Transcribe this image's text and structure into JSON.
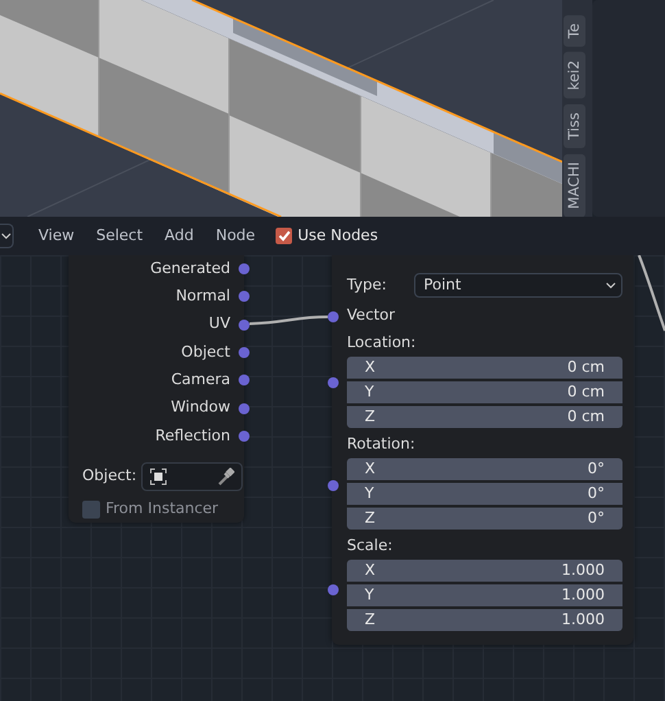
{
  "viewport": {
    "side_tabs": [
      "Te",
      "kei2",
      "Tiss",
      "MACHI"
    ]
  },
  "header": {
    "menus": [
      "View",
      "Select",
      "Add",
      "Node"
    ],
    "use_nodes": {
      "label": "Use Nodes",
      "checked": true
    }
  },
  "texture_coordinate_node": {
    "outputs": [
      "Generated",
      "Normal",
      "UV",
      "Object",
      "Camera",
      "Window",
      "Reflection"
    ],
    "object_label": "Object:",
    "from_instancer": {
      "label": "From Instancer",
      "checked": false
    }
  },
  "mapping_node": {
    "type_label": "Type:",
    "type_value": "Point",
    "vector_input": "Vector",
    "groups": [
      {
        "label": "Location:",
        "fields": [
          {
            "axis": "X",
            "value": "0 cm"
          },
          {
            "axis": "Y",
            "value": "0 cm"
          },
          {
            "axis": "Z",
            "value": "0 cm"
          }
        ]
      },
      {
        "label": "Rotation:",
        "fields": [
          {
            "axis": "X",
            "value": "0°"
          },
          {
            "axis": "Y",
            "value": "0°"
          },
          {
            "axis": "Z",
            "value": "0°"
          }
        ]
      },
      {
        "label": "Scale:",
        "fields": [
          {
            "axis": "X",
            "value": "1.000"
          },
          {
            "axis": "Y",
            "value": "1.000"
          },
          {
            "axis": "Z",
            "value": "1.000"
          }
        ]
      }
    ]
  }
}
